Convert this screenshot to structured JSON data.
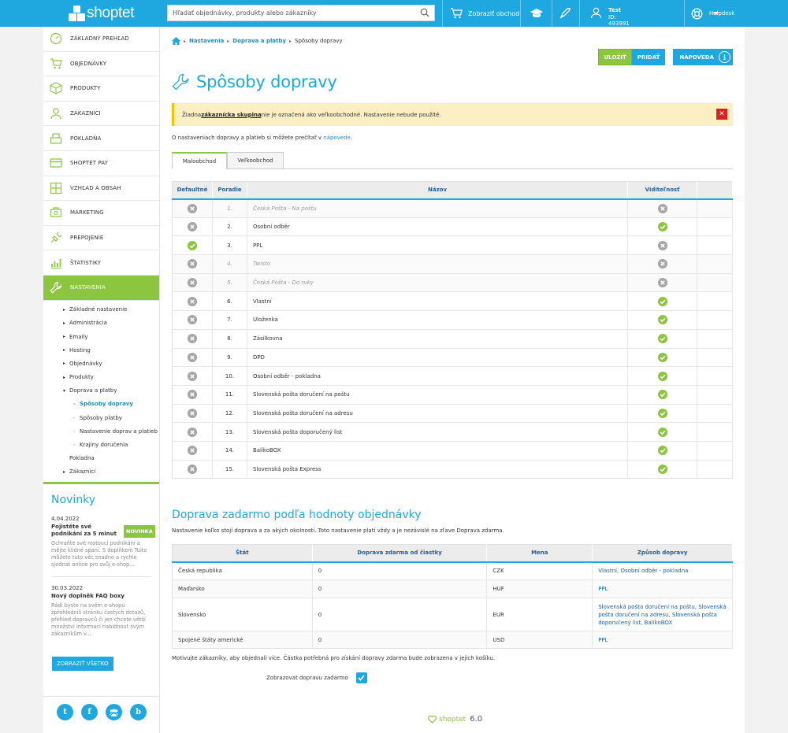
{
  "topbar": {
    "logo_text": "shoptet",
    "search_placeholder": "Hľadať objednávky, produkty alebo zákazníky",
    "show_store": "Zobraziť obchod",
    "user_name": "Test",
    "user_id": "ID: 493991",
    "helpdesk": "Helpdesk"
  },
  "sidebar": {
    "items": [
      {
        "label": "Základný prehľad",
        "icon": "dashboard-icon"
      },
      {
        "label": "Objednávky",
        "icon": "cart-icon"
      },
      {
        "label": "Produkty",
        "icon": "box-icon"
      },
      {
        "label": "Zákazníci",
        "icon": "user-icon"
      },
      {
        "label": "Pokladňa",
        "icon": "register-icon"
      },
      {
        "label": "Shoptet Pay",
        "icon": "card-icon"
      },
      {
        "label": "Vzhľad a obsah",
        "icon": "layout-icon"
      },
      {
        "label": "Marketing",
        "icon": "megaphone-icon"
      },
      {
        "label": "Prepojenie",
        "icon": "plug-icon"
      },
      {
        "label": "Štatistiky",
        "icon": "chart-icon"
      },
      {
        "label": "Nastavenia",
        "icon": "wrench-icon"
      }
    ],
    "sub": [
      {
        "label": "Základné nastavenie",
        "level": 1,
        "arrow": "▸"
      },
      {
        "label": "Administrácia",
        "level": 1,
        "arrow": "▸"
      },
      {
        "label": "Emaily",
        "level": 1,
        "arrow": "▸"
      },
      {
        "label": "Hosting",
        "level": 1,
        "arrow": "▸"
      },
      {
        "label": "Objednávky",
        "level": 1,
        "arrow": "▸"
      },
      {
        "label": "Produkty",
        "level": 1,
        "arrow": "▸"
      },
      {
        "label": "Doprava a platby",
        "level": 1,
        "arrow": "▾"
      },
      {
        "label": "Spôsoby dopravy",
        "level": 2,
        "active": true
      },
      {
        "label": "Spôsoby platby",
        "level": 2
      },
      {
        "label": "Nastavenie doprav a platieb",
        "level": 2
      },
      {
        "label": "Krajiny doručenia",
        "level": 2
      },
      {
        "label": "Pokladna",
        "level": 1,
        "arrow": ""
      },
      {
        "label": "Zákazníci",
        "level": 1,
        "arrow": "▸"
      }
    ],
    "news_title": "Novinky",
    "news": [
      {
        "date": "4.04.2022",
        "title": "Pojistěte své podnikání za 5 minut",
        "badge": "NOVINKA",
        "text": "Ochraňte své rostoucí podnikání a mějte klidné spaní. S doplňkem Tuito můžete tuto věc snadno a rychle sjednat online pro svůj e-shop..."
      },
      {
        "date": "30.03.2022",
        "title": "Nový doplněk FAQ boxy",
        "badge": "",
        "text": "Rádi byste na svém e-shopu zpřehlednili stránku častých dotazů, přehled dopravců či jen chcete větší množství informací nabídnout svým zákazníkům v..."
      }
    ],
    "show_all": "ZOBRAZIŤ VŠETKO"
  },
  "breadcrumb": {
    "items": [
      "Nastavenia",
      "Doprava a platby"
    ],
    "current": "Spôsoby dopravy"
  },
  "actions": {
    "save": "ULOŽIŤ",
    "add": "PRIDAŤ",
    "help": "NÁPOVEDA"
  },
  "page_title": "Spôsoby dopravy",
  "alert": {
    "before": "Žiadna ",
    "link": "zákaznícka skupina",
    "after": " nie je označená ako veľkoobchodné. Nastavenie nebude použité."
  },
  "intro": {
    "text": "O nastaveniach dopravy a platieb si môžete prečítať v ",
    "link": "nápovede",
    "end": "."
  },
  "tabs": [
    "Maloobchod",
    "Veľkoobchod"
  ],
  "shipping_table": {
    "headers": [
      "Defaultné",
      "Poradie",
      "Názov",
      "Viditeľnosť"
    ],
    "rows": [
      {
        "default": false,
        "order": "1.",
        "name": "Česká Pošta - Na poštu",
        "visible": false,
        "disabled": true
      },
      {
        "default": false,
        "order": "2.",
        "name": "Osobní odběr",
        "visible": true,
        "disabled": false
      },
      {
        "default": true,
        "order": "3.",
        "name": "PPL",
        "visible": false,
        "disabled": false
      },
      {
        "default": false,
        "order": "4.",
        "name": "Twisto",
        "visible": false,
        "disabled": true
      },
      {
        "default": false,
        "order": "5.",
        "name": "Česká Pošta - Do ruky",
        "visible": false,
        "disabled": true
      },
      {
        "default": false,
        "order": "6.",
        "name": "Vlastní",
        "visible": true,
        "disabled": false
      },
      {
        "default": false,
        "order": "7.",
        "name": "Uloženka",
        "visible": true,
        "disabled": false
      },
      {
        "default": false,
        "order": "8.",
        "name": "Zásilkovna",
        "visible": true,
        "disabled": false
      },
      {
        "default": false,
        "order": "9.",
        "name": "DPD",
        "visible": true,
        "disabled": false
      },
      {
        "default": false,
        "order": "10.",
        "name": "Osobní odběr - pokladna",
        "visible": true,
        "disabled": false
      },
      {
        "default": false,
        "order": "11.",
        "name": "Slovenská pošta doručení na poštu",
        "visible": true,
        "disabled": false
      },
      {
        "default": false,
        "order": "12.",
        "name": "Slovenská pošta doručení na adresu",
        "visible": true,
        "disabled": false
      },
      {
        "default": false,
        "order": "13.",
        "name": "Slovenská pošta doporučený list",
        "visible": true,
        "disabled": false
      },
      {
        "default": false,
        "order": "14.",
        "name": "BalíkoBOX",
        "visible": true,
        "disabled": false
      },
      {
        "default": false,
        "order": "15.",
        "name": "Slovenská pošta Express",
        "visible": true,
        "disabled": false
      }
    ]
  },
  "free_shipping": {
    "title": "Doprava zadarmo podľa hodnoty objednávky",
    "desc": "Nastavenie koľko stojí doprava a za akých okolností. Toto nastavenie platí vždy a je nezávislé na zľave Doprava zdarma.",
    "headers": [
      "Štát",
      "Doprava zdarma od čiastky",
      "Mena",
      "Způsob dopravy"
    ],
    "rows": [
      {
        "country": "Česká republika",
        "amount": "0",
        "currency": "CZK",
        "methods": "Vlastní, Osobní odběr - pokladna"
      },
      {
        "country": "Maďarsko",
        "amount": "0",
        "currency": "HUF",
        "methods": "PPL"
      },
      {
        "country": "Slovensko",
        "amount": "0",
        "currency": "EUR",
        "methods": "Slovenská pošta doručení na poštu, Slovenská pošta doručení na adresu, Slovenská pošta doporučený list, BalíkoBOX"
      },
      {
        "country": "Spojené štáty americké",
        "amount": "0",
        "currency": "USD",
        "methods": "PPL"
      }
    ],
    "note": "Motivujte zákazníky, aby objednali více. Částka potřebná pro získání dopravy zdarma bude zobrazena v jejich košíku.",
    "checkbox_label": "Zobrazovat dopravu zadarmo"
  },
  "footer": {
    "brand": "shoptet",
    "version": "6.0"
  },
  "colors": {
    "primary": "#1fa8e0",
    "accent": "#8cc63f",
    "danger": "#e02020",
    "warning": "#fcefc4"
  }
}
